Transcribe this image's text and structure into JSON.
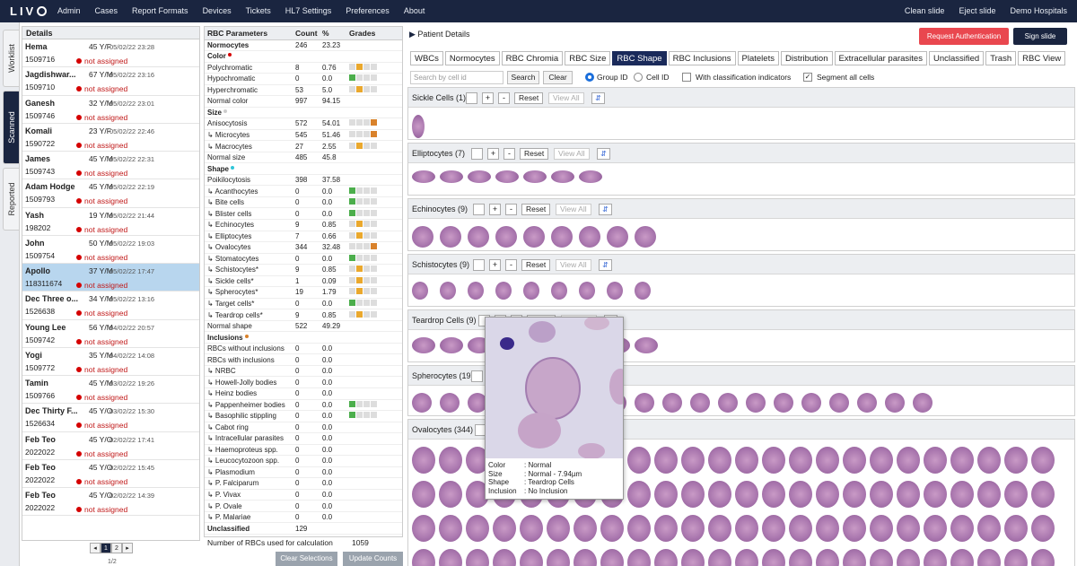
{
  "app": {
    "logo": "LIV",
    "nav": [
      "Admin",
      "Cases",
      "Report Formats",
      "Devices",
      "Tickets",
      "HL7 Settings",
      "Preferences",
      "About"
    ],
    "right_nav": [
      "Clean slide",
      "Eject slide",
      "Demo Hospitals"
    ]
  },
  "vertical_tabs": [
    "Worklist",
    "Scanned",
    "Reported"
  ],
  "details": {
    "header": "Details",
    "patients": [
      {
        "name": "Hema",
        "age": "45 Y/F",
        "date": "05/02/22 23:28",
        "id": "1509716",
        "status": "not assigned"
      },
      {
        "name": "Jagdishwar...",
        "age": "67 Y/M",
        "date": "05/02/22 23:16",
        "id": "1509710",
        "status": "not assigned"
      },
      {
        "name": "Ganesh",
        "age": "32 Y/M",
        "date": "05/02/22 23:01",
        "id": "1509746",
        "status": "not assigned"
      },
      {
        "name": "Komali",
        "age": "23 Y/F",
        "date": "05/02/22 22:46",
        "id": "1590722",
        "status": "not assigned"
      },
      {
        "name": "James",
        "age": "45 Y/M",
        "date": "05/02/22 22:31",
        "id": "1509743",
        "status": "not assigned"
      },
      {
        "name": "Adam Hodge",
        "age": "45 Y/M",
        "date": "05/02/22 22:19",
        "id": "1509793",
        "status": "not assigned"
      },
      {
        "name": "Yash",
        "age": "19 Y/M",
        "date": "05/02/22 21:44",
        "id": "198202",
        "status": "not assigned"
      },
      {
        "name": "John",
        "age": "50 Y/M",
        "date": "05/02/22 19:03",
        "id": "1509754",
        "status": "not assigned"
      },
      {
        "name": "Apollo",
        "age": "37 Y/M",
        "date": "05/02/22 17:47",
        "id": "118311674",
        "status": "not assigned"
      },
      {
        "name": "Dec Three o...",
        "age": "34 Y/M",
        "date": "05/02/22 13:16",
        "id": "1526638",
        "status": "not assigned"
      },
      {
        "name": "Young Lee",
        "age": "56 Y/M",
        "date": "04/02/22 20:57",
        "id": "1509742",
        "status": "not assigned"
      },
      {
        "name": "Yogi",
        "age": "35 Y/M",
        "date": "04/02/22 14:08",
        "id": "1509772",
        "status": "not assigned"
      },
      {
        "name": "Tamin",
        "age": "45 Y/M",
        "date": "03/02/22 19:26",
        "id": "1509766",
        "status": "not assigned"
      },
      {
        "name": "Dec Thirty F...",
        "age": "45 Y/O",
        "date": "03/02/22 15:30",
        "id": "1526634",
        "status": "not assigned"
      },
      {
        "name": "Feb Teo",
        "age": "45 Y/O",
        "date": "02/02/22 17:41",
        "id": "2022022",
        "status": "not assigned"
      },
      {
        "name": "Feb Teo",
        "age": "45 Y/O",
        "date": "02/02/22 15:45",
        "id": "2022022",
        "status": "not assigned"
      },
      {
        "name": "Feb Teo",
        "age": "45 Y/O",
        "date": "02/02/22 14:39",
        "id": "2022022",
        "status": "not assigned"
      }
    ],
    "selected_index": 8,
    "pager": {
      "pages": [
        "1",
        "2"
      ],
      "current": "1",
      "summary": "1/2"
    }
  },
  "params": {
    "headers": [
      "RBC Parameters",
      "Count",
      "%",
      "Grades"
    ],
    "rows": [
      {
        "name": "Normocytes",
        "count": "246",
        "pct": "23.23",
        "grade": "",
        "sec": true
      },
      {
        "name": "Color",
        "count": "",
        "pct": "",
        "grade": "",
        "sec": true,
        "dot": "#d50000"
      },
      {
        "name": "Polychromatic",
        "count": "8",
        "pct": "0.76",
        "grade": "y1"
      },
      {
        "name": "Hypochromatic",
        "count": "0",
        "pct": "0.0",
        "grade": "g0"
      },
      {
        "name": "Hyperchromatic",
        "count": "53",
        "pct": "5.0",
        "grade": "y1"
      },
      {
        "name": "Normal color",
        "count": "997",
        "pct": "94.15",
        "grade": ""
      },
      {
        "name": "Size",
        "count": "",
        "pct": "",
        "grade": "",
        "sec": true,
        "dot": "#cccccc"
      },
      {
        "name": "Anisocytosis",
        "count": "572",
        "pct": "54.01",
        "grade": "o3"
      },
      {
        "name": "↳ Microcytes",
        "count": "545",
        "pct": "51.46",
        "grade": "o3"
      },
      {
        "name": "↳ Macrocytes",
        "count": "27",
        "pct": "2.55",
        "grade": "y1"
      },
      {
        "name": "Normal size",
        "count": "485",
        "pct": "45.8",
        "grade": ""
      },
      {
        "name": "Shape",
        "count": "",
        "pct": "",
        "grade": "",
        "sec": true,
        "dot": "#2fc5d8"
      },
      {
        "name": "Poikilocytosis",
        "count": "398",
        "pct": "37.58",
        "grade": ""
      },
      {
        "name": "↳ Acanthocytes",
        "count": "0",
        "pct": "0.0",
        "grade": "g0"
      },
      {
        "name": "↳ Bite cells",
        "count": "0",
        "pct": "0.0",
        "grade": "g0"
      },
      {
        "name": "↳ Blister cells",
        "count": "0",
        "pct": "0.0",
        "grade": "g0"
      },
      {
        "name": "↳ Echinocytes",
        "count": "9",
        "pct": "0.85",
        "grade": "y1"
      },
      {
        "name": "↳ Elliptocytes",
        "count": "7",
        "pct": "0.66",
        "grade": "y1"
      },
      {
        "name": "↳ Ovalocytes",
        "count": "344",
        "pct": "32.48",
        "grade": "o3"
      },
      {
        "name": "↳ Stomatocytes",
        "count": "0",
        "pct": "0.0",
        "grade": "g0"
      },
      {
        "name": "↳ Schistocytes*",
        "count": "9",
        "pct": "0.85",
        "grade": "y1"
      },
      {
        "name": "↳ Sickle cells*",
        "count": "1",
        "pct": "0.09",
        "grade": "y1"
      },
      {
        "name": "↳ Spherocytes*",
        "count": "19",
        "pct": "1.79",
        "grade": "y1"
      },
      {
        "name": "↳ Target cells*",
        "count": "0",
        "pct": "0.0",
        "grade": "g0"
      },
      {
        "name": "↳ Teardrop cells*",
        "count": "9",
        "pct": "0.85",
        "grade": "y1"
      },
      {
        "name": "Normal shape",
        "count": "522",
        "pct": "49.29",
        "grade": ""
      },
      {
        "name": "Inclusions",
        "count": "",
        "pct": "",
        "grade": "",
        "sec": true,
        "dot": "#d9822b"
      },
      {
        "name": "RBCs without inclusions",
        "count": "0",
        "pct": "0.0",
        "grade": ""
      },
      {
        "name": "RBCs with inclusions",
        "count": "0",
        "pct": "0.0",
        "grade": ""
      },
      {
        "name": "↳ NRBC",
        "count": "0",
        "pct": "0.0",
        "grade": ""
      },
      {
        "name": "↳ Howell-Jolly bodies",
        "count": "0",
        "pct": "0.0",
        "grade": ""
      },
      {
        "name": "↳ Heinz bodies",
        "count": "0",
        "pct": "0.0",
        "grade": ""
      },
      {
        "name": "↳ Pappenheimer bodies",
        "count": "0",
        "pct": "0.0",
        "grade": "g0"
      },
      {
        "name": "↳ Basophilic stippling",
        "count": "0",
        "pct": "0.0",
        "grade": "g0"
      },
      {
        "name": "↳ Cabot ring",
        "count": "0",
        "pct": "0.0",
        "grade": ""
      },
      {
        "name": "↳ Intracellular parasites",
        "count": "0",
        "pct": "0.0",
        "grade": ""
      },
      {
        "name": "↳ Haemoproteus spp.",
        "count": "0",
        "pct": "0.0",
        "grade": ""
      },
      {
        "name": "↳ Leucocytozoon spp.",
        "count": "0",
        "pct": "0.0",
        "grade": ""
      },
      {
        "name": "↳ Plasmodium",
        "count": "0",
        "pct": "0.0",
        "grade": ""
      },
      {
        "name": "↳ P. Falciparum",
        "count": "0",
        "pct": "0.0",
        "grade": ""
      },
      {
        "name": "↳ P. Vivax",
        "count": "0",
        "pct": "0.0",
        "grade": ""
      },
      {
        "name": "↳ P. Ovale",
        "count": "0",
        "pct": "0.0",
        "grade": ""
      },
      {
        "name": "↳ P. Malariae",
        "count": "0",
        "pct": "0.0",
        "grade": ""
      },
      {
        "name": "Unclassified",
        "count": "129",
        "pct": "",
        "grade": "",
        "sec": true
      }
    ],
    "rbc_used_label": "Number of RBCs used for calculation",
    "rbc_used_value": "1059",
    "clear_selections": "Clear Selections",
    "update_counts": "Update Counts"
  },
  "right": {
    "title": "Patient Details",
    "request_auth": "Request Authentication",
    "sign_slide": "Sign slide",
    "tabs": [
      "WBCs",
      "Normocytes",
      "RBC Chromia",
      "RBC Size",
      "RBC Shape",
      "RBC Inclusions",
      "Platelets",
      "Distribution",
      "Extracellular parasites",
      "Unclassified",
      "Trash",
      "RBC View"
    ],
    "active_tab": "RBC Shape",
    "search": {
      "placeholder": "Search by cell id",
      "search_btn": "Search",
      "clear_btn": "Clear",
      "group_id": "Group ID",
      "cell_id": "Cell ID",
      "with_indicators": "With classification indicators",
      "segment_all": "Segment all cells"
    },
    "group_controls": {
      "plus": "+",
      "minus": "-",
      "reset": "Reset",
      "view_all": "View All",
      "sort": "⇵"
    },
    "groups": [
      {
        "title": "Sickle Cells (1)",
        "count": 1
      },
      {
        "title": "Elliptocytes (7)",
        "count": 7
      },
      {
        "title": "Echinocytes (9)",
        "count": 9
      },
      {
        "title": "Schistocytes (9)",
        "count": 9
      },
      {
        "title": "Teardrop Cells (9)",
        "count": 9
      },
      {
        "title": "Spherocytes (19)",
        "count": 19
      },
      {
        "title": "Ovalocytes (344)",
        "count": 344
      }
    ],
    "popup": {
      "color_k": "Color",
      "color_v": ": Normal",
      "size_k": "Size",
      "size_v": ": Normal - 7.94µm",
      "shape_k": "Shape",
      "shape_v": ": Teardrop Cells",
      "incl_k": "Inclusion",
      "incl_v": ": No Inclusion"
    }
  }
}
